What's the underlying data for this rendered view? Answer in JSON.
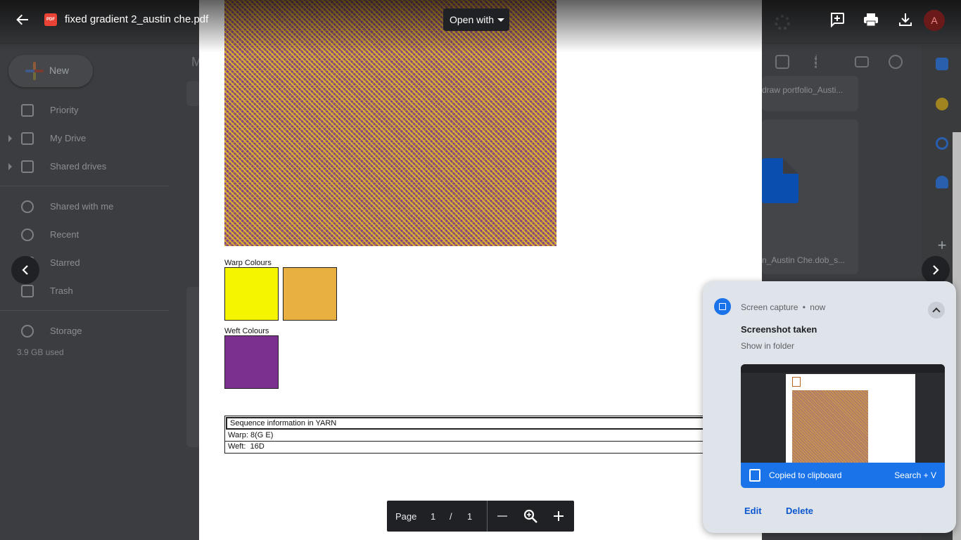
{
  "drive": {
    "new_label": "New",
    "nav": [
      "Priority",
      "My Drive",
      "Shared drives",
      "Shared with me",
      "Recent",
      "Starred",
      "Trash",
      "Storage"
    ],
    "storage_used": "3.9 GB used",
    "main_title_fragment": "M",
    "file_names": [
      "draw portfolio_Austi...",
      "n_Austin Che.dob_s..."
    ]
  },
  "viewer": {
    "file_title": "fixed gradient 2_austin che.pdf",
    "pdf_badge": "PDF",
    "open_with": "Open with",
    "avatar_letter": "A"
  },
  "document": {
    "warp_colours_label": "Warp Colours",
    "weft_colours_label": "Weft Colours",
    "warp_colours": [
      "#f5f500",
      "#e8b040"
    ],
    "weft_colours": [
      "#7b2f8e"
    ],
    "sequence": {
      "header": "Sequence information in YARN",
      "rows": [
        "Warp: 8(G E)",
        "Weft:  16D"
      ]
    }
  },
  "page_controls": {
    "label": "Page",
    "current": "1",
    "separator": "/",
    "total": "1"
  },
  "notification": {
    "source": "Screen capture",
    "dot": "•",
    "time": "now",
    "title": "Screenshot taken",
    "subtitle": "Show in folder",
    "clipboard_text": "Copied to clipboard",
    "shortcut": "Search + V",
    "edit": "Edit",
    "delete": "Delete"
  },
  "colors": {
    "accent": "#1a73e8",
    "pdf_red": "#ea4335",
    "viewer_dark": "#202124"
  }
}
